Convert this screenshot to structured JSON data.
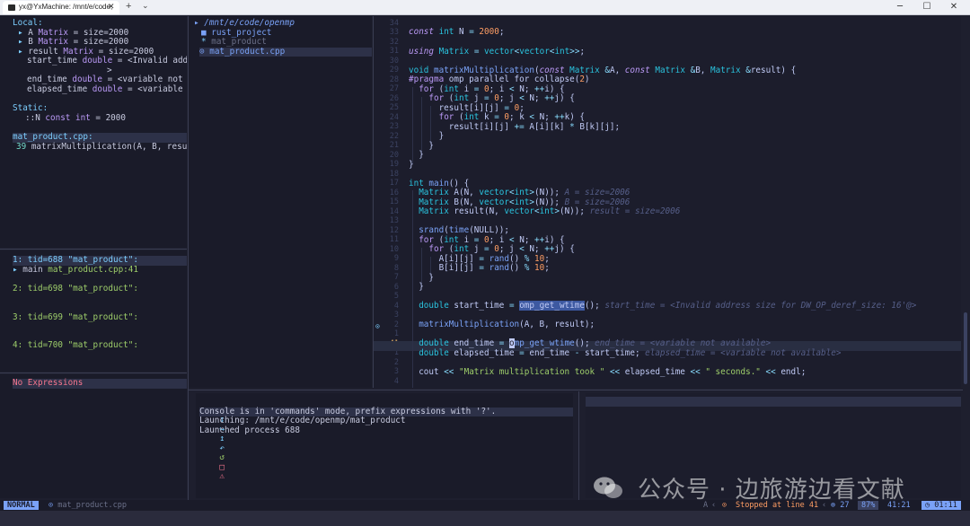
{
  "window": {
    "tab_title": "yx@YxMachine: /mnt/e/code,",
    "close_glyph": "✕",
    "new_tab_glyph": "+",
    "tab_menu_glyph": "⌄",
    "minimize_glyph": "─",
    "maximize_glyph": "☐",
    "close_window_glyph": "✕"
  },
  "variables": {
    "local_header": "Local:",
    "local": [
      {
        "arrow": "▸",
        "name": "A",
        "type": "Matrix",
        "value": "= size=2000"
      },
      {
        "arrow": "▸",
        "name": "B",
        "type": "Matrix",
        "value": "= size=2000"
      },
      {
        "arrow": "▸",
        "name": "result",
        "type": "Matrix",
        "value": "= size=2000"
      },
      {
        "arrow": "",
        "name": "start_time",
        "type": "double",
        "value": "= <Invalid addres"
      },
      {
        "arrow": "",
        "name": "",
        "type": "",
        "value": ">"
      },
      {
        "arrow": "",
        "name": "end_time",
        "type": "double",
        "value": "= <variable not ava"
      },
      {
        "arrow": "",
        "name": "elapsed_time",
        "type": "double",
        "value": "= <variable not"
      }
    ],
    "static_header": "Static:",
    "static": [
      {
        "name": "::N",
        "type": "const int",
        "value": "= 2000"
      }
    ],
    "stack_header": "mat_product.cpp:",
    "stack": [
      {
        "line": "39",
        "text": "matrixMultiplication(A, B, result)"
      }
    ]
  },
  "threads": [
    {
      "label": "1: tid=688 \"mat_product\":",
      "frame_arrow": "▸",
      "frame": "main",
      "frame_loc": "mat_product.cpp:41",
      "selected": true
    },
    {
      "label": "2: tid=698 \"mat_product\":"
    },
    {
      "label": "3: tid=699 \"mat_product\":"
    },
    {
      "label": "4: tid=700 \"mat_product\":"
    }
  ],
  "watch": {
    "empty_text": "No Expressions"
  },
  "files": {
    "root": "/mnt/e/code/openmp",
    "items": [
      {
        "icon": "folder",
        "name": "rust_project"
      },
      {
        "icon": "asterisk",
        "name": "mat_product"
      },
      {
        "icon": "cpp",
        "name": "mat_product.cpp",
        "selected": true
      }
    ]
  },
  "editor": {
    "gutter": [
      "34",
      "33",
      "32",
      "31",
      "30",
      "29",
      "28",
      "27",
      "26",
      "25",
      "24",
      "23",
      "22",
      "21",
      "20",
      "19",
      "18",
      "17",
      "16",
      "15",
      "14",
      "13",
      "12",
      "11",
      "10",
      "9",
      "8",
      "7",
      "6",
      "5",
      "4",
      "3",
      "2",
      "1",
      "41",
      "1",
      "2",
      "3",
      "4"
    ],
    "current_line_number": "41",
    "virtual_texts": {
      "A": "A = size=2006",
      "B": "B = size=2006",
      "result": "result = size=2006",
      "start_time": "start_time = <Invalid address size for DW_OP_deref_size: 16'@>",
      "end_time": "end_time = <variable not available>",
      "elapsed_time": "elapsed_time = <variable not available>"
    }
  },
  "console": {
    "controls": [
      "▷",
      "↧",
      "↪",
      "↥",
      "↶",
      "↺",
      "□",
      "⚠"
    ],
    "lines": [
      "Console is in 'commands' mode, prefix expressions with '?'.",
      "Launching: /mnt/e/code/openmp/mat_product",
      "Launched process 688"
    ]
  },
  "statusbar": {
    "mode": "NORMAL",
    "file": "mat_product.cpp",
    "right_a": "A",
    "stopped": "Stopped at line 41",
    "count": "27",
    "percent": "87%",
    "position": "41:21",
    "clock": "01:11"
  },
  "watermark": "公众号 · 边旅游边看文献",
  "colors": {
    "background": "#1e1f2e",
    "accent": "#7aa2f7",
    "cyan": "#7dcfff",
    "breakpoint": "#e0af68"
  }
}
